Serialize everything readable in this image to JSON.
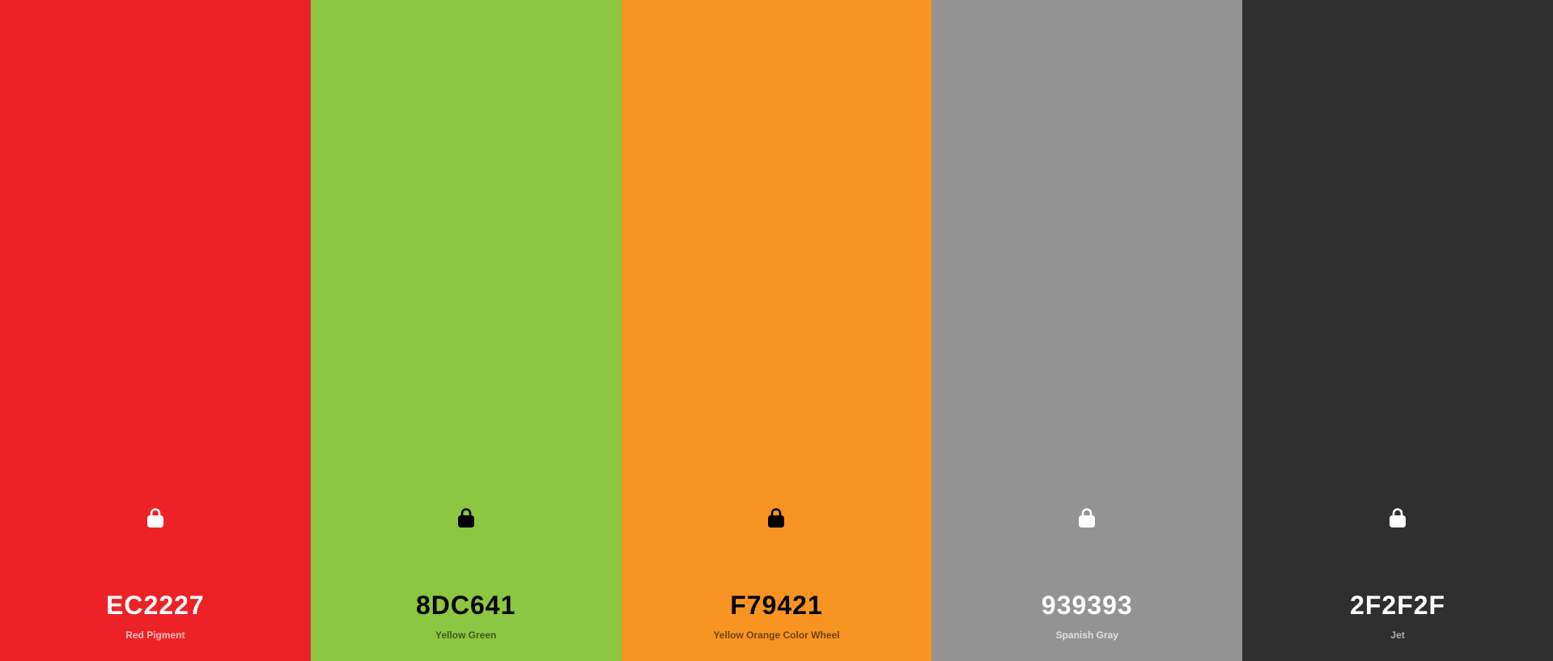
{
  "swatches": [
    {
      "hex": "EC2227",
      "name": "Red Pigment",
      "color": "#EC2227",
      "text_color": "#FFFFFF",
      "sub_color": "rgba(255,255,255,0.7)",
      "icon": "lock-icon"
    },
    {
      "hex": "8DC641",
      "name": "Yellow Green",
      "color": "#8DC641",
      "text_color": "#000000",
      "sub_color": "rgba(0,0,0,0.55)",
      "icon": "lock-icon"
    },
    {
      "hex": "F79421",
      "name": "Yellow Orange Color Wheel",
      "color": "#F79421",
      "text_color": "#000000",
      "sub_color": "rgba(0,0,0,0.55)",
      "icon": "lock-icon"
    },
    {
      "hex": "939393",
      "name": "Spanish Gray",
      "color": "#939393",
      "text_color": "#FFFFFF",
      "sub_color": "rgba(255,255,255,0.7)",
      "icon": "lock-icon"
    },
    {
      "hex": "2F2F2F",
      "name": "Jet",
      "color": "#2F2F2F",
      "text_color": "#FFFFFF",
      "sub_color": "rgba(255,255,255,0.6)",
      "icon": "lock-icon"
    }
  ]
}
